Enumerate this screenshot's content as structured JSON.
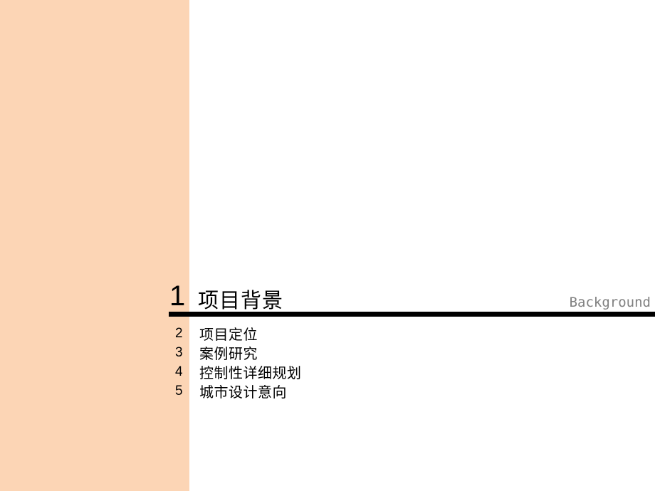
{
  "colors": {
    "side_panel": "#fcd5b5",
    "rule": "#000000",
    "subtitle": "#808080"
  },
  "current_section": {
    "number": "1",
    "title": "项目背景",
    "subtitle": "Background"
  },
  "toc": {
    "items": [
      {
        "number": "2",
        "label": "项目定位"
      },
      {
        "number": "3",
        "label": "案例研究"
      },
      {
        "number": "4",
        "label": "控制性详细规划"
      },
      {
        "number": "5",
        "label": "城市设计意向"
      }
    ]
  }
}
